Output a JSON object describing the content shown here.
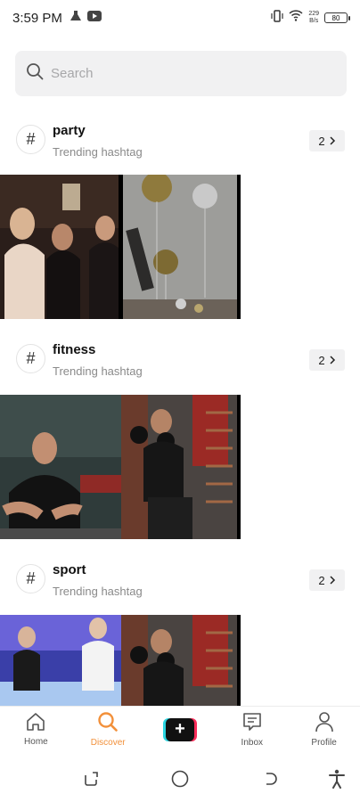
{
  "status": {
    "time": "3:59 PM",
    "speed_top": "229",
    "speed_bottom": "B/s",
    "battery": "80"
  },
  "search": {
    "placeholder": "Search"
  },
  "hashtags": [
    {
      "name": "party",
      "subtitle": "Trending hashtag",
      "count": "2"
    },
    {
      "name": "fitness",
      "subtitle": "Trending hashtag",
      "count": "2"
    },
    {
      "name": "sport",
      "subtitle": "Trending hashtag",
      "count": "2"
    }
  ],
  "nav": {
    "home": "Home",
    "discover": "Discover",
    "inbox": "Inbox",
    "profile": "Profile"
  },
  "colors": {
    "accent": "#f2903a",
    "plus_cyan": "#2ad4e0",
    "plus_red": "#fb2c5a"
  },
  "icons": [
    "flask-icon",
    "youtube-icon",
    "vibrate-icon",
    "wifi-icon",
    "battery-icon",
    "search-icon",
    "hashtag-icon",
    "chevron-right-icon",
    "home-icon",
    "discover-icon",
    "plus-icon",
    "inbox-icon",
    "profile-icon",
    "recents-icon",
    "home-circle-icon",
    "back-icon",
    "accessibility-icon"
  ]
}
